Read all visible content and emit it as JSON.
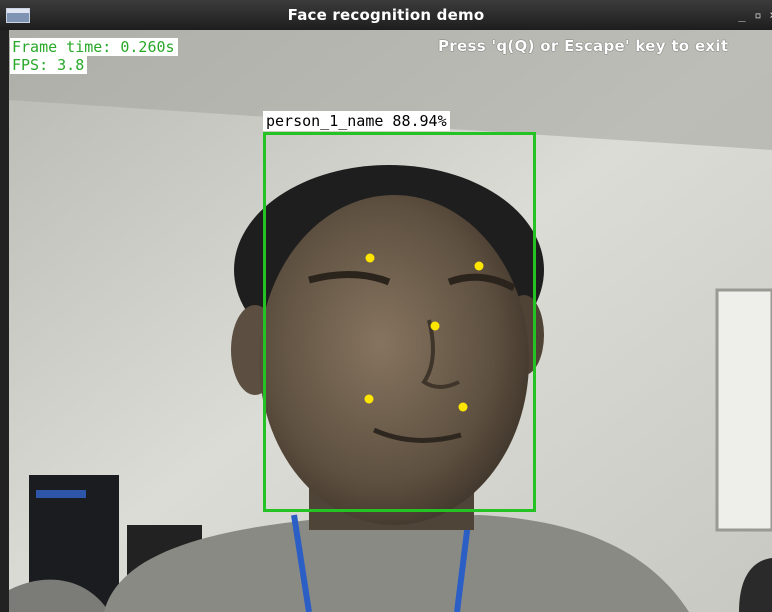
{
  "window": {
    "title": "Face recognition demo",
    "minimize_glyph": "_",
    "maximize_glyph": "▫",
    "close_glyph": "×"
  },
  "overlay": {
    "frame_time": "Frame time: 0.260s",
    "fps": "FPS: 3.8",
    "exit_hint": "Press 'q(Q) or Escape' key to exit"
  },
  "detections": [
    {
      "label": "person_1_name 88.94%",
      "box_color": "#25c224",
      "landmark_color": "#ffe600"
    }
  ],
  "colors": {
    "stat_text": "#29a829",
    "box": "#25c224",
    "landmarks": "#ffe600"
  }
}
